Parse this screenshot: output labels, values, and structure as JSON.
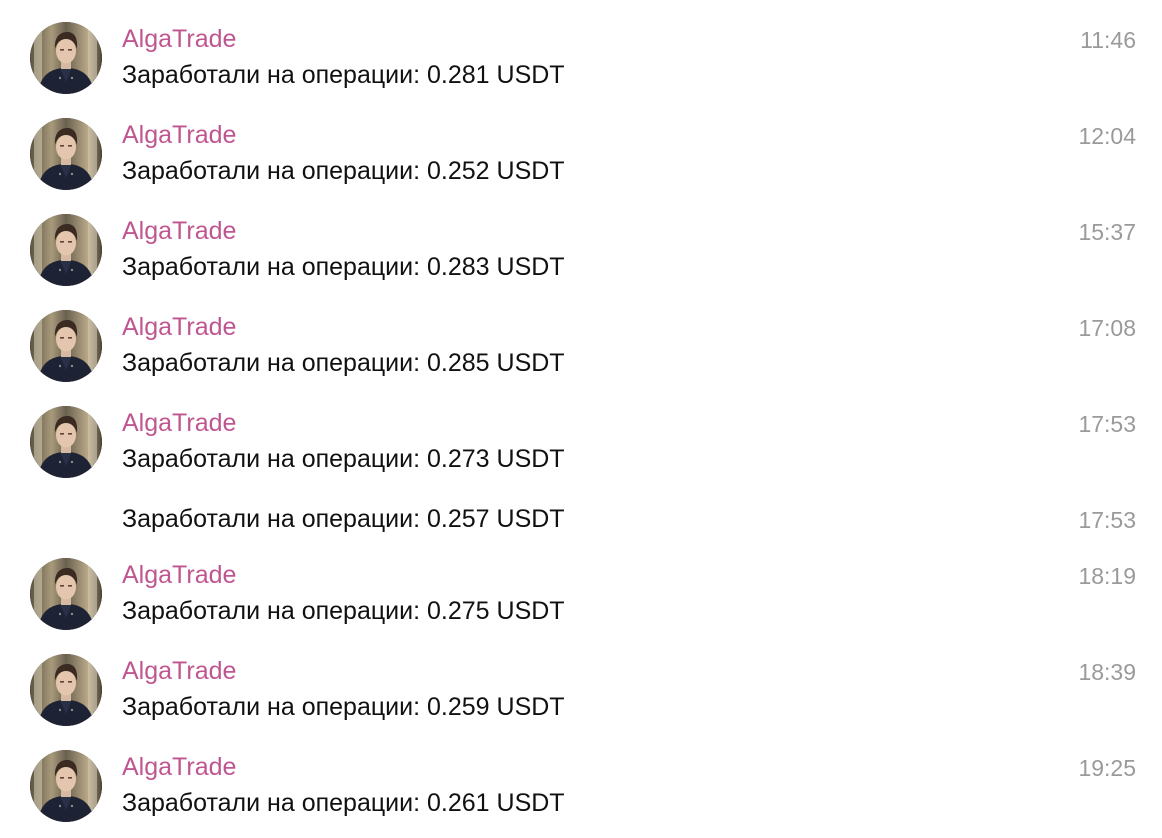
{
  "messages": [
    {
      "sender": "AlgaTrade",
      "text": "Заработали на операции: 0.281 USDT",
      "time": "11:46",
      "show_avatar": true
    },
    {
      "sender": "AlgaTrade",
      "text": "Заработали на операции: 0.252 USDT",
      "time": "12:04",
      "show_avatar": true
    },
    {
      "sender": "AlgaTrade",
      "text": "Заработали на операции: 0.283 USDT",
      "time": "15:37",
      "show_avatar": true
    },
    {
      "sender": "AlgaTrade",
      "text": "Заработали на операции: 0.285 USDT",
      "time": "17:08",
      "show_avatar": true
    },
    {
      "sender": "AlgaTrade",
      "text": "Заработали на операции: 0.273 USDT",
      "time": "17:53",
      "show_avatar": true
    },
    {
      "sender": "",
      "text": "Заработали на операции: 0.257 USDT",
      "time": "17:53",
      "show_avatar": false
    },
    {
      "sender": "AlgaTrade",
      "text": "Заработали на операции: 0.275 USDT",
      "time": "18:19",
      "show_avatar": true
    },
    {
      "sender": "AlgaTrade",
      "text": "Заработали на операции: 0.259 USDT",
      "time": "18:39",
      "show_avatar": true
    },
    {
      "sender": "AlgaTrade",
      "text": "Заработали на операции: 0.261 USDT",
      "time": "19:25",
      "show_avatar": true
    }
  ],
  "colors": {
    "sender": "#c0568f",
    "text": "#111111",
    "time": "#9a9a9a",
    "background": "#ffffff"
  },
  "icons": {
    "avatar": "user-avatar-photo"
  }
}
